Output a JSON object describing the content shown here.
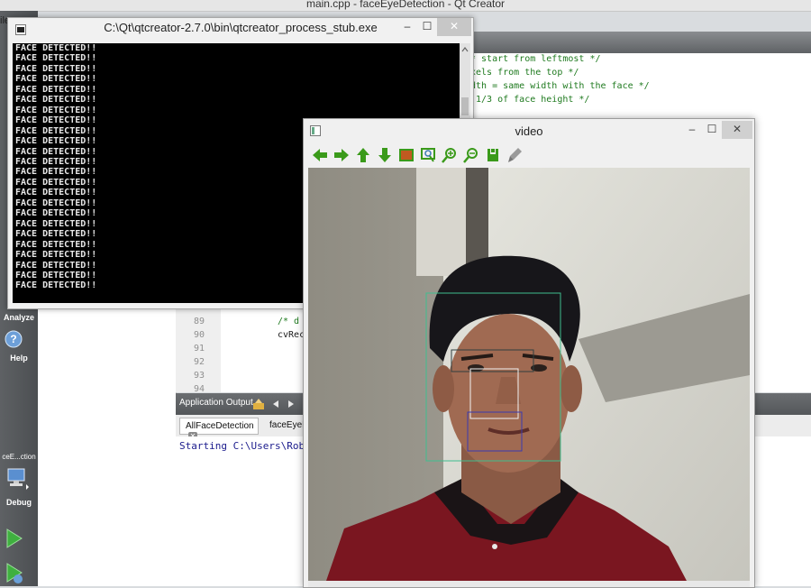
{
  "qt": {
    "title": "main.cpp - faceEyeDetection - Qt Creator",
    "menu_fragment": "ile",
    "sidebar": {
      "analyze": "Analyze",
      "help": "Help",
      "project": "ceE...ction",
      "debug": "Debug"
    },
    "code_top": [
      "* start from leftmost */",
      "xels from the top */",
      "dth = same width with the face */",
      " 1/3 of face height */"
    ],
    "line_numbers": [
      "89",
      "90",
      "91",
      "92",
      "93",
      "94"
    ],
    "code_lines": [
      "/* d",
      "cvRec"
    ],
    "app_output": "Application Output",
    "output_tabs": [
      "AllFaceDetection",
      "faceEyeD"
    ],
    "output_text": "Starting C:\\Users\\Robe"
  },
  "console": {
    "title": "C:\\Qt\\qtcreator-2.7.0\\bin\\qtcreator_process_stub.exe",
    "lines": [
      "FACE DETECTED!!",
      "FACE DETECTED!!",
      "FACE DETECTED!!",
      "FACE DETECTED!!",
      "FACE DETECTED!!",
      "FACE DETECTED!!",
      "FACE DETECTED!!",
      "FACE DETECTED!!",
      "FACE DETECTED!!",
      "FACE DETECTED!!",
      "FACE DETECTED!!",
      "FACE DETECTED!!",
      "FACE DETECTED!!",
      "FACE DETECTED!!",
      "FACE DETECTED!!",
      "FACE DETECTED!!",
      "FACE DETECTED!!",
      "FACE DETECTED!!",
      "FACE DETECTED!!",
      "FACE DETECTED!!",
      "FACE DETECTED!!",
      "FACE DETECTED!!",
      "FACE DETECTED!!",
      "FACE DETECTED!!"
    ],
    "buttons": {
      "minimize": "–",
      "maximize": "☐",
      "close": "✕"
    }
  },
  "video": {
    "title": "video",
    "toolbar_icons": [
      "arrow-left-icon",
      "arrow-right-icon",
      "arrow-up-icon",
      "arrow-down-icon",
      "image-icon",
      "zoom-fit-icon",
      "zoom-in-icon",
      "zoom-out-icon",
      "save-icon",
      "properties-icon"
    ],
    "buttons": {
      "minimize": "–",
      "maximize": "☐",
      "close": "✕"
    },
    "detection_colors": {
      "face": "#3fbf8f",
      "eyes": "#2f3f3f",
      "nose": "#f2f2f2",
      "mouth": "#3a3ab0"
    }
  },
  "colors": {
    "code_comment": "#1f7a1f",
    "toolbar_green": "#3a9a1a"
  }
}
